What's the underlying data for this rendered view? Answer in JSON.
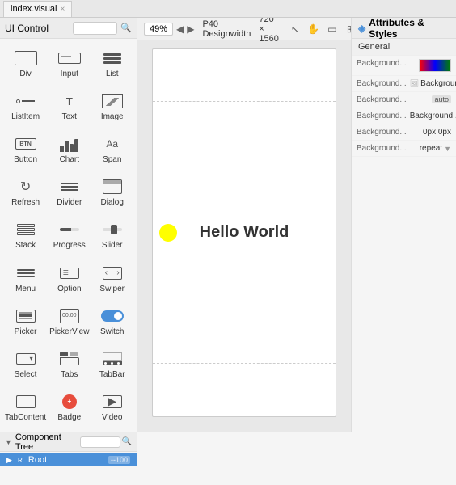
{
  "tab": {
    "label": "index.visual",
    "close": "×"
  },
  "left_panel": {
    "title": "UI Control",
    "search_placeholder": "",
    "components": [
      {
        "id": "div",
        "label": "Div",
        "icon": "div"
      },
      {
        "id": "input",
        "label": "Input",
        "icon": "input"
      },
      {
        "id": "list",
        "label": "List",
        "icon": "list"
      },
      {
        "id": "listitem",
        "label": "ListItem",
        "icon": "listitem"
      },
      {
        "id": "text",
        "label": "Text",
        "icon": "text"
      },
      {
        "id": "image",
        "label": "Image",
        "icon": "image"
      },
      {
        "id": "button",
        "label": "Button",
        "icon": "button"
      },
      {
        "id": "chart",
        "label": "Chart",
        "icon": "chart"
      },
      {
        "id": "span",
        "label": "Span",
        "icon": "span"
      },
      {
        "id": "refresh",
        "label": "Refresh",
        "icon": "refresh"
      },
      {
        "id": "divider",
        "label": "Divider",
        "icon": "divider"
      },
      {
        "id": "dialog",
        "label": "Dialog",
        "icon": "dialog"
      },
      {
        "id": "stack",
        "label": "Stack",
        "icon": "stack"
      },
      {
        "id": "progress",
        "label": "Progress",
        "icon": "progress"
      },
      {
        "id": "slider",
        "label": "Slider",
        "icon": "slider"
      },
      {
        "id": "menu",
        "label": "Menu",
        "icon": "menu"
      },
      {
        "id": "option",
        "label": "Option",
        "icon": "option"
      },
      {
        "id": "swiper",
        "label": "Swiper",
        "icon": "swiper"
      },
      {
        "id": "picker",
        "label": "Picker",
        "icon": "picker"
      },
      {
        "id": "pickerview",
        "label": "PickerView",
        "icon": "pickerview"
      },
      {
        "id": "switch",
        "label": "Switch",
        "icon": "switch"
      },
      {
        "id": "select",
        "label": "Select",
        "icon": "select"
      },
      {
        "id": "tabs",
        "label": "Tabs",
        "icon": "tabs"
      },
      {
        "id": "tabbar",
        "label": "TabBar",
        "icon": "tabbar"
      },
      {
        "id": "tabcontent",
        "label": "TabContent",
        "icon": "tabcontent"
      },
      {
        "id": "badge",
        "label": "Badge",
        "icon": "badge"
      },
      {
        "id": "video",
        "label": "Video",
        "icon": "video"
      }
    ]
  },
  "canvas": {
    "device": "P40 Designwidth",
    "resolution": "720 × 1560",
    "zoom": "49%",
    "hello_world": "Hello World"
  },
  "right_panel": {
    "title": "Attributes & Styles",
    "section": "General",
    "attrs": [
      {
        "label": "Background...",
        "type": "color"
      },
      {
        "label": "Background...",
        "type": "text",
        "value": "Background..."
      },
      {
        "label": "Background...",
        "type": "auto",
        "value": "auto"
      },
      {
        "label": "Background...",
        "type": "expand",
        "value": "Background..."
      },
      {
        "label": "Background...",
        "type": "text",
        "value": "0px 0px"
      },
      {
        "label": "Background...",
        "type": "expand",
        "value": "repeat"
      }
    ]
  },
  "component_tree": {
    "title": "Component Tree",
    "collapse": "▼",
    "search_placeholder": "",
    "items": [
      {
        "label": "Root",
        "badge": "--100",
        "selected": true,
        "arrow": "▶",
        "icon": "R"
      }
    ]
  },
  "icons": {
    "search": "🔍",
    "expand_right": "▶",
    "expand_down": "▼",
    "color_icon": "🎨",
    "panel_collapse": "◀"
  }
}
